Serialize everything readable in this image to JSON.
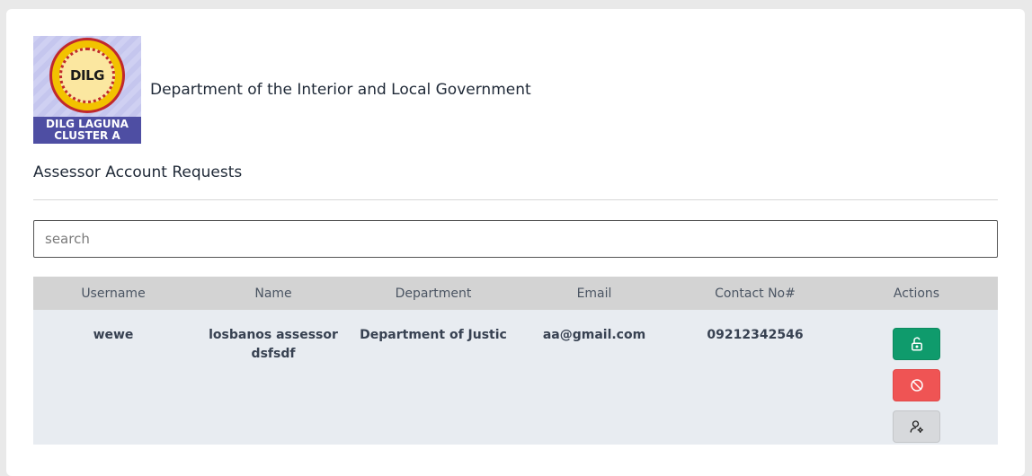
{
  "logo": {
    "text": "DILG",
    "band_line1": "DILG LAGUNA",
    "band_line2": "CLUSTER A"
  },
  "header": {
    "org_name": "Department of the Interior and Local Government"
  },
  "section": {
    "title": "Assessor Account Requests"
  },
  "search": {
    "placeholder": "search",
    "value": ""
  },
  "table": {
    "headers": [
      "Username",
      "Name",
      "Department",
      "Email",
      "Contact No#",
      "Actions"
    ],
    "rows": [
      {
        "username": "wewe",
        "name": "losbanos assessor dsfsdf",
        "department": "Department of Justic",
        "email": "aa@gmail.com",
        "contact": "09212342546",
        "actions": [
          "unlock-icon",
          "block-icon",
          "user-settings-icon"
        ]
      }
    ]
  },
  "colors": {
    "approve": "#0f9b6c",
    "reject": "#ef5454",
    "settings": "#d7d9dc",
    "header_bg": "#d3d3d3",
    "row_bg": "#e8ecf1"
  }
}
